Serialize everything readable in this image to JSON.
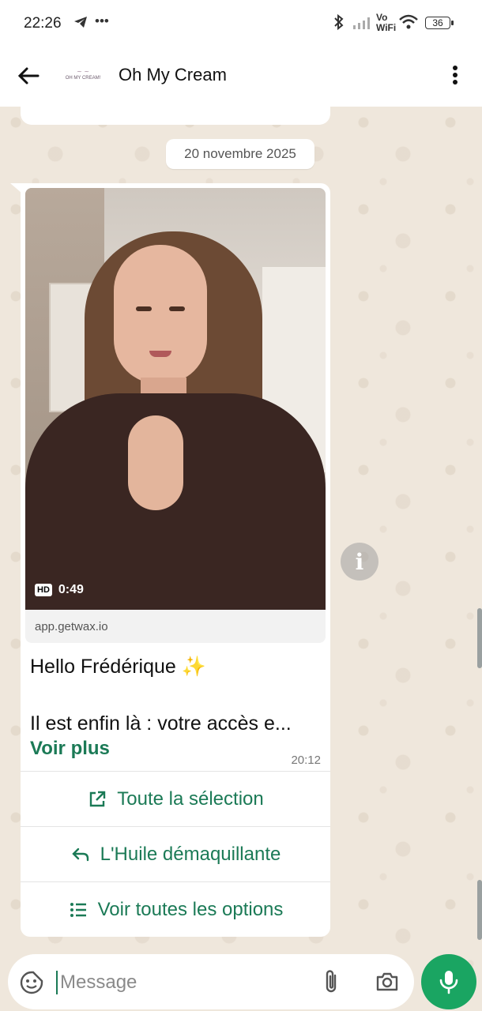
{
  "status_bar": {
    "time": "22:26",
    "network_label": "Vo WiFi",
    "battery": "36"
  },
  "header": {
    "avatar_text": "OH MY CREAM!",
    "contact_name": "Oh My Cream"
  },
  "chat": {
    "date_chip": "20 novembre 2025",
    "video": {
      "duration": "0:49",
      "quality_badge": "HD",
      "link": "app.getwax.io"
    },
    "message": {
      "greeting": "Hello Frédérique ✨",
      "body": "Il est enfin là : votre accès e...",
      "see_more": "Voir plus",
      "time": "20:12"
    },
    "actions": [
      {
        "label": "Toute la sélection",
        "icon": "external-link-icon"
      },
      {
        "label": "L'Huile démaquillante",
        "icon": "reply-icon"
      },
      {
        "label": "Voir toutes les options",
        "icon": "list-icon"
      }
    ]
  },
  "composer": {
    "placeholder": "Message"
  },
  "colors": {
    "accent_green": "#1b7a56",
    "mic_green": "#1aa562",
    "wallpaper": "#efe7dc"
  }
}
